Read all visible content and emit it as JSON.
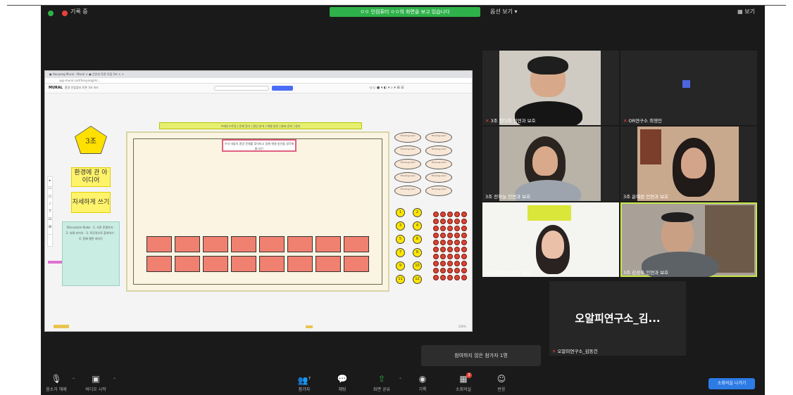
{
  "top_bar": {
    "recording_label": "기록 중",
    "share_banner": "ㅇㅇ 인컴퓨터 ㅇㅇ의 화면을 보고 있습니다",
    "view_options": "옵션 보기 ▾",
    "view_button": "보기"
  },
  "shared_screen": {
    "browser_tabs": "● Hanyang Mural - Mural   ×   ● 인안과 토론 모둠 3조   ×   +",
    "browser_url": "app.mural.co/t/hanyang/m/...",
    "mural_logo": "MURAL",
    "board_name": "환경 인컴퓨터 토론 3조 보드",
    "tools": "◁ ◇ ● ▾   ◐ ▾   ⌕ ▾   ⊞ ☰",
    "group_label": "3조",
    "sticky_1": "환경에 관 아이디어",
    "sticky_2": "자세하게 쓰기",
    "teal_note": "Discussion Rules · 1. 서로 존중하기 · 2. 차례 지키기 · 3. 적극적으로 참여하기 · 4. 함께 결론 내리기",
    "topic_bar": "브레인스토밍 | 문제 찾기 | 원인 분석 | 해결 방안 | 발표 준비 | 정리",
    "ribbon_text": "우리 마을의 환경 문제를 찾아보고 함께 해결 방안을 생각해 봅시다!",
    "oval_labels": [
      "Thinking Card",
      "Thinking Card",
      "Thinking Card",
      "Thinking Card",
      "Thinking Card",
      "Thinking Card",
      "Thinking Card",
      "Thinking Card",
      "Thinking Card",
      "Thinking Card"
    ],
    "circle_labels": [
      "1",
      "2",
      "3",
      "4",
      "5",
      "6",
      "7",
      "8",
      "9",
      "10",
      "11",
      "12"
    ],
    "zoom_level": "100%"
  },
  "participants": [
    {
      "name": "3조 한다희 인연과 보호",
      "mic_muted": true
    },
    {
      "name": "OR연구소 최영민",
      "mic_muted": true
    },
    {
      "name": "3조 전하늘 인연과 보호",
      "mic_muted": false
    },
    {
      "name": "3조 윤예원 인연과 보호",
      "mic_muted": false
    },
    {
      "name": "3조 김정희 인연과 보호",
      "mic_muted": false
    },
    {
      "name": "3조 김성우 인연과 보호",
      "mic_muted": false
    },
    {
      "name": "오알피연구소_김동건",
      "mic_muted": true,
      "display_text": "오알피연구소_김..."
    }
  ],
  "toast": "참여하지 않은 참가자 1명",
  "bottom_bar": {
    "mute": "음소거 해제",
    "video": "비디오 시작",
    "participants": "참가자",
    "participants_count": "7",
    "chat": "채팅",
    "share": "화면 공유",
    "record": "기록",
    "breakout": "소회의실",
    "breakout_badge": "3",
    "reactions": "반응",
    "leave": "소회의실 나가기"
  },
  "colors": {
    "zoom_bg": "#1a1a1a",
    "share_green": "#2eb14a",
    "leave_blue": "#2d7be5",
    "speaker_outline": "#c8e94a",
    "sticky_yellow": "#fff36b",
    "card_salmon": "#f08070"
  }
}
